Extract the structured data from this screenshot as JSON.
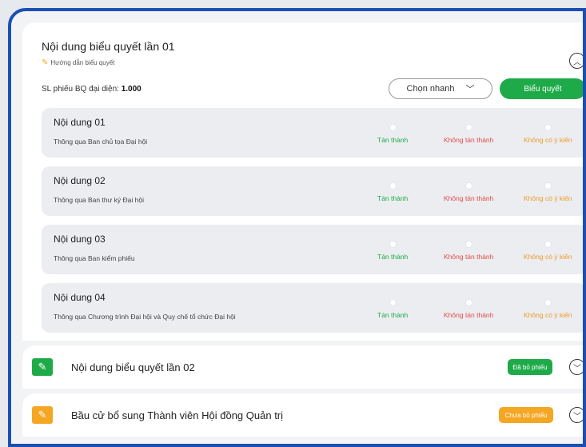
{
  "section1": {
    "title": "Nội dung biểu quyết lần 01",
    "guide_label": "Hướng dẫn biểu quyết",
    "sl_label": "SL phiếu BQ đại diện:",
    "sl_value": "1.000",
    "quick_select_label": "Chọn nhanh",
    "vote_button_label": "Biểu quyết",
    "options": {
      "agree": "Tán thành",
      "disagree": "Không tán thành",
      "no_opinion": "Không có ý kiến"
    },
    "items": [
      {
        "title": "Nội dung 01",
        "desc": "Thông qua Ban chủ tọa Đại hội"
      },
      {
        "title": "Nội dung 02",
        "desc": "Thông qua Ban thư ký Đại hội"
      },
      {
        "title": "Nội dung 03",
        "desc": "Thông qua Ban kiểm phiếu"
      },
      {
        "title": "Nội dung 04",
        "desc": "Thông qua Chương trình Đại hội và Quy chế tổ chức Đại hội"
      }
    ]
  },
  "section2": {
    "title": "Nội dung biểu quyết lần 02",
    "status": "Đã bỏ phiếu",
    "status_color": "#1faa4a"
  },
  "section3": {
    "title": "Bầu cử bổ sung Thành viên Hội đồng Quản trị",
    "status": "Chưa bỏ phiếu",
    "status_color": "#f5a623"
  }
}
